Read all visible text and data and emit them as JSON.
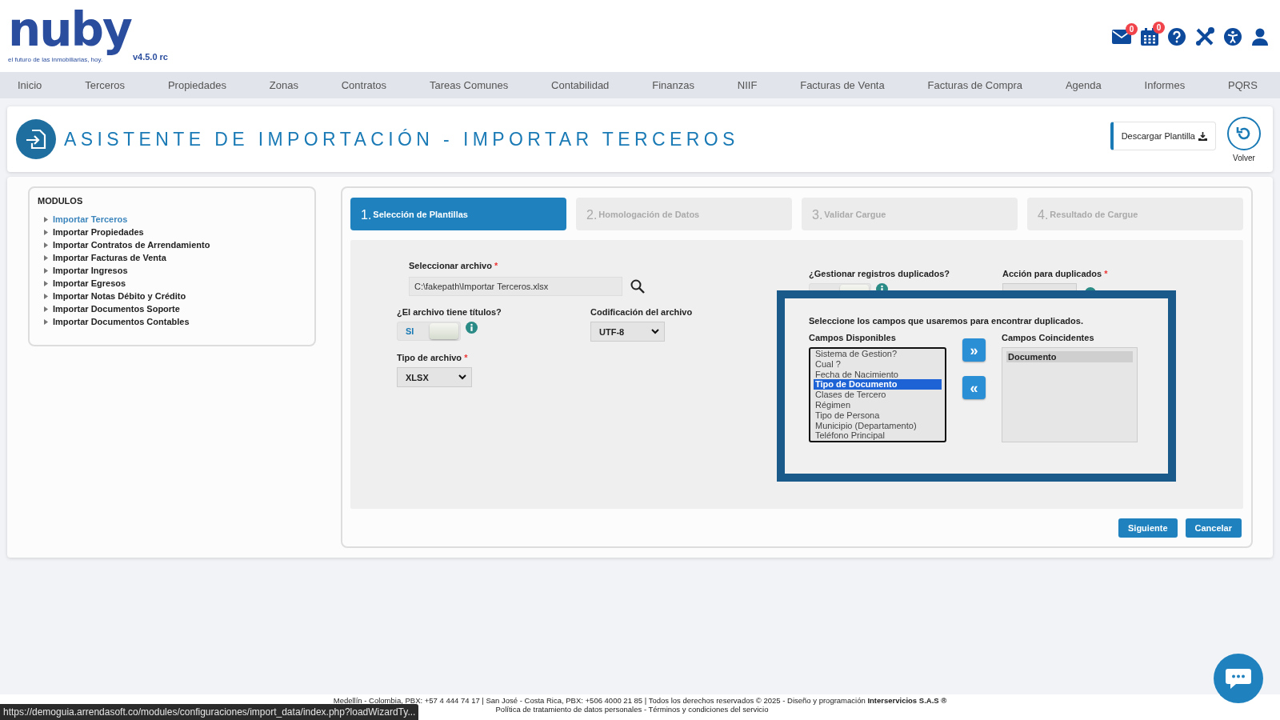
{
  "header": {
    "logo": {
      "text": "nuby",
      "tagline": "el futuro de las inmobiliarias, hoy.",
      "version": "v4.5.0 rc"
    },
    "notifications": [
      {
        "count": "0"
      },
      {
        "count": "0"
      }
    ]
  },
  "nav": [
    "Inicio",
    "Terceros",
    "Propiedades",
    "Zonas",
    "Contratos",
    "Tareas Comunes",
    "Contabilidad",
    "Finanzas",
    "NIIF",
    "Facturas de Venta",
    "Facturas de Compra",
    "Agenda",
    "Informes",
    "PQRS"
  ],
  "title_bar": {
    "title": "ASISTENTE DE IMPORTACIÓN - IMPORTAR TERCEROS",
    "download_button": "Descargar Plantilla",
    "back_label": "Volver"
  },
  "sidebar": {
    "title": "MODULOS",
    "items": [
      {
        "label": "Importar Terceros",
        "selected": true
      },
      {
        "label": "Importar Propiedades",
        "selected": false
      },
      {
        "label": "Importar Contratos de Arrendamiento",
        "selected": false
      },
      {
        "label": "Importar Facturas de Venta",
        "selected": false
      },
      {
        "label": "Importar Ingresos",
        "selected": false
      },
      {
        "label": "Importar Egresos",
        "selected": false
      },
      {
        "label": "Importar Notas Débito y Crédito",
        "selected": false
      },
      {
        "label": "Importar Documentos Soporte",
        "selected": false
      },
      {
        "label": "Importar Documentos Contables",
        "selected": false
      }
    ]
  },
  "steps": [
    {
      "number": "1.",
      "label": "Selección de Plantillas",
      "selected": true
    },
    {
      "number": "2.",
      "label": "Homologación de Datos",
      "selected": false
    },
    {
      "number": "3.",
      "label": "Validar Cargue",
      "selected": false
    },
    {
      "number": "4.",
      "label": "Resultado de Cargue",
      "selected": false
    }
  ],
  "form": {
    "file": {
      "label": "Seleccionar archivo",
      "required_mark": "*",
      "value": "C:\\fakepath\\Importar Terceros.xlsx"
    },
    "has_titles": {
      "label": "¿El archivo tiene títulos?",
      "on": true,
      "on_text": "SI"
    },
    "encoding": {
      "label": "Codificación del archivo",
      "value": "UTF-8"
    },
    "file_type": {
      "label": "Tipo de archivo",
      "required_mark": "*",
      "value": "XLSX"
    },
    "duplicates": {
      "label": "¿Gestionar registros duplicados?",
      "on": true
    },
    "duplicate_action": {
      "label": "Acción para duplicados",
      "required_mark": "*"
    }
  },
  "duplicates_dialog": {
    "instruction": "Seleccione los campos que usaremos para encontrar duplicados.",
    "available_title": "Campos Disponibles",
    "available": [
      {
        "label": "Sistema de Gestion?",
        "selected": false
      },
      {
        "label": "Cual ?",
        "selected": false
      },
      {
        "label": "Fecha de Nacimiento",
        "selected": false
      },
      {
        "label": "Tipo de Documento",
        "selected": true
      },
      {
        "label": "Clases de Tercero",
        "selected": false
      },
      {
        "label": "Régimen",
        "selected": false
      },
      {
        "label": "Tipo de Persona",
        "selected": false
      },
      {
        "label": "Municipio (Departamento)",
        "selected": false
      },
      {
        "label": "Teléfono Principal",
        "selected": false
      }
    ],
    "add_button": "»",
    "remove_button": "«",
    "matching_title": "Campos Coincidentes",
    "matching": [
      {
        "label": "Documento",
        "selected": true
      }
    ]
  },
  "actions": [
    "Siguiente",
    "Cancelar"
  ],
  "footer": {
    "line1": "Medellín - Colombia, PBX: +57 4 444 74 17 | San José - Costa Rica, PBX: +506 4000 21 85 | Todos los derechos reservados © 2025 - Diseño y programación **Interservicios S.A.S ®**",
    "line2": "Política de tratamiento de datos personales - Términos y condiciones del servicio"
  },
  "status_url": "https://demoguia.arrendasoft.co/modules/configuraciones/import_data/index.php?loadWizardTy..."
}
